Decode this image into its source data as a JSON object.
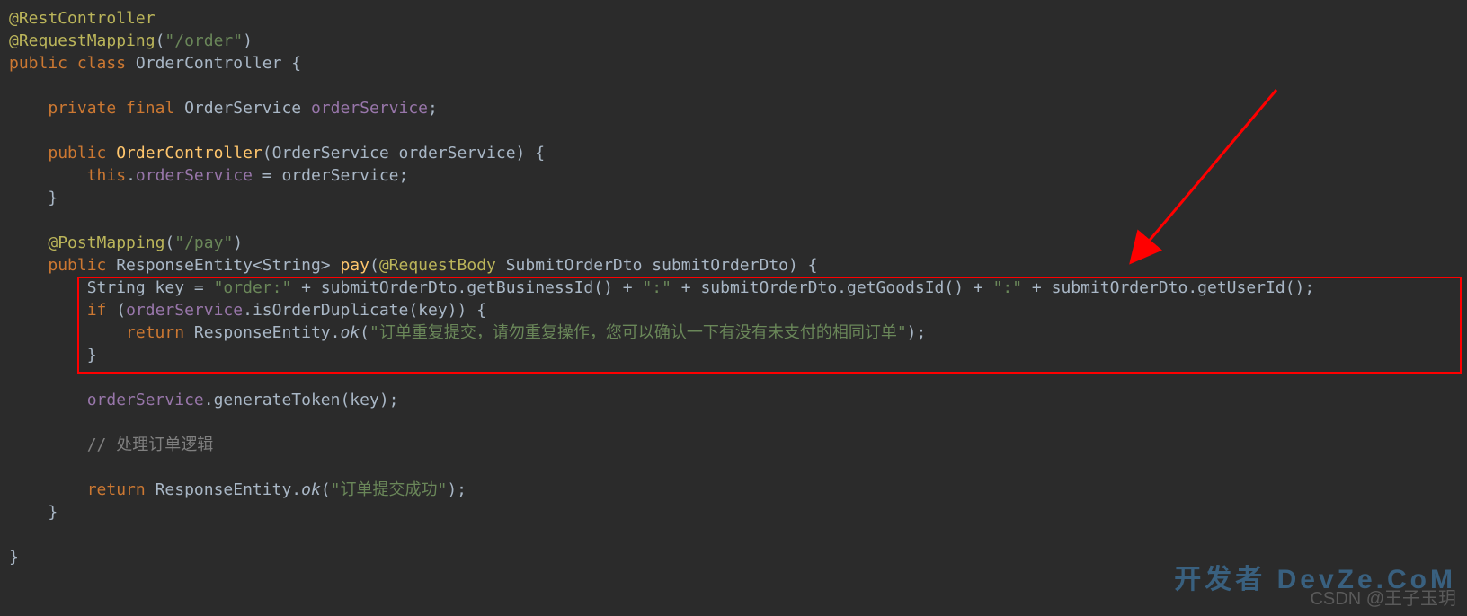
{
  "code": {
    "l1_ann": "@RestController",
    "l2_ann": "@RequestMapping",
    "l2_paren_open": "(",
    "l2_str": "\"/order\"",
    "l2_paren_close": ")",
    "l3_kw_public": "public ",
    "l3_kw_class": "class ",
    "l3_type": "OrderController",
    "l3_brace": " {",
    "l5_indent": "    ",
    "l5_kw": "private final ",
    "l5_type": "OrderService ",
    "l5_field": "orderService",
    "l5_semi": ";",
    "l7_indent": "    ",
    "l7_kw": "public ",
    "l7_m": "OrderController",
    "l7_paren": "(OrderService orderService) {",
    "l8_indent": "        ",
    "l8_this": "this",
    "l8_dot": ".",
    "l8_field": "orderService",
    "l8_rest": " = orderService;",
    "l9_close": "    }",
    "l11_indent": "    ",
    "l11_ann": "@PostMapping",
    "l11_paren_open": "(",
    "l11_str": "\"/pay\"",
    "l11_paren_close": ")",
    "l12_indent": "    ",
    "l12_kw": "public ",
    "l12_ret": "ResponseEntity<String> ",
    "l12_m": "pay",
    "l12_paren_open": "(",
    "l12_ann": "@RequestBody ",
    "l12_param": "SubmitOrderDto submitOrderDto",
    "l12_paren_close": ") {",
    "l13_indent": "        ",
    "l13_a": "String key = ",
    "l13_s1": "\"order:\"",
    "l13_p1": " + submitOrderDto.getBusinessId() + ",
    "l13_s2": "\":\"",
    "l13_p2": " + submitOrderDto.getGoodsId() + ",
    "l13_s3": "\":\"",
    "l13_p3": " + submitOrderDto.getUserId();",
    "l14_indent": "        ",
    "l14_if": "if ",
    "l14_cond_open": "(",
    "l14_field": "orderService",
    "l14_cond_rest": ".isOrderDuplicate(key)) {",
    "l15_indent": "            ",
    "l15_ret": "return ",
    "l15_call": "ResponseEntity.",
    "l15_ok": "ok",
    "l15_paren_open": "(",
    "l15_str": "\"订单重复提交，请勿重复操作，您可以确认一下有没有未支付的相同订单\"",
    "l15_paren_close": ");",
    "l16_close": "        }",
    "l18_indent": "        ",
    "l18_field": "orderService",
    "l18_rest": ".generateToken(key);",
    "l20_comment": "        // 处理订单逻辑",
    "l22_indent": "        ",
    "l22_ret": "return ",
    "l22_call": "ResponseEntity.",
    "l22_ok": "ok",
    "l22_paren_open": "(",
    "l22_str": "\"订单提交成功\"",
    "l22_paren_close": ");",
    "l23_close": "    }",
    "l25_close": "}"
  },
  "watermark_bottom": "CSDN @王子玉玥",
  "watermark_brand": "开发者  DevZe.CoM"
}
